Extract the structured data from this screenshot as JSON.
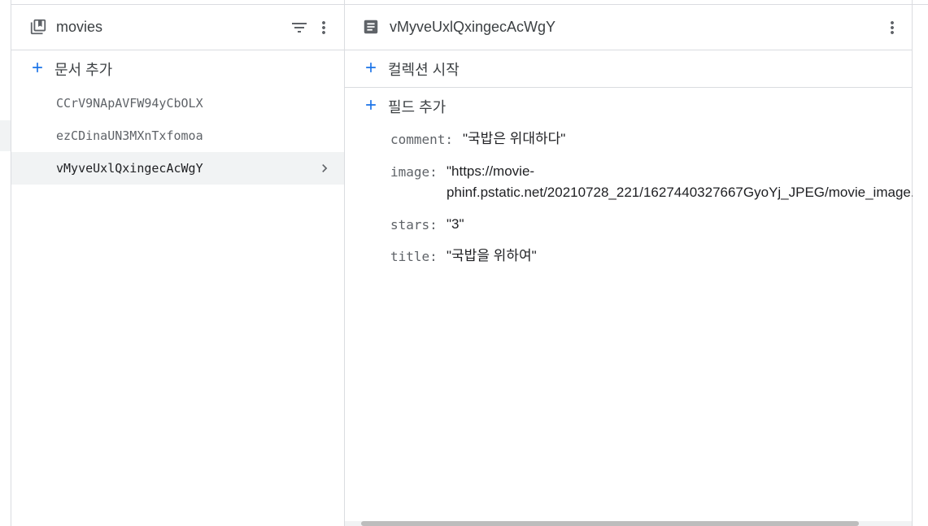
{
  "collection_panel": {
    "title": "movies",
    "add_document_label": "문서 추가",
    "documents": [
      {
        "id": "CCrV9NApAVFW94yCbOLX",
        "selected": false
      },
      {
        "id": "ezCDinaUN3MXnTxfomoa",
        "selected": false
      },
      {
        "id": "vMyveUxlQxingecAcWgY",
        "selected": true
      }
    ]
  },
  "document_panel": {
    "title": "vMyveUxlQxingecAcWgY",
    "start_collection_label": "컬렉션 시작",
    "add_field_label": "필드 추가",
    "fields": [
      {
        "key": "comment:",
        "value": "\"국밥은 위대하다\""
      },
      {
        "key": "image:",
        "value_line1": "\"https://movie-",
        "value_line2": "phinf.pstatic.net/20210728_221/1627440327667GyoYj_JPEG/movie_image.jpg\""
      },
      {
        "key": "stars:",
        "value": "\"3\""
      },
      {
        "key": "title:",
        "value": "\"국밥을 위하여\""
      }
    ]
  },
  "colors": {
    "accent": "#1a73e8",
    "icon": "#5f6368",
    "border": "#dadce0",
    "selected_bg": "#f1f3f4"
  }
}
